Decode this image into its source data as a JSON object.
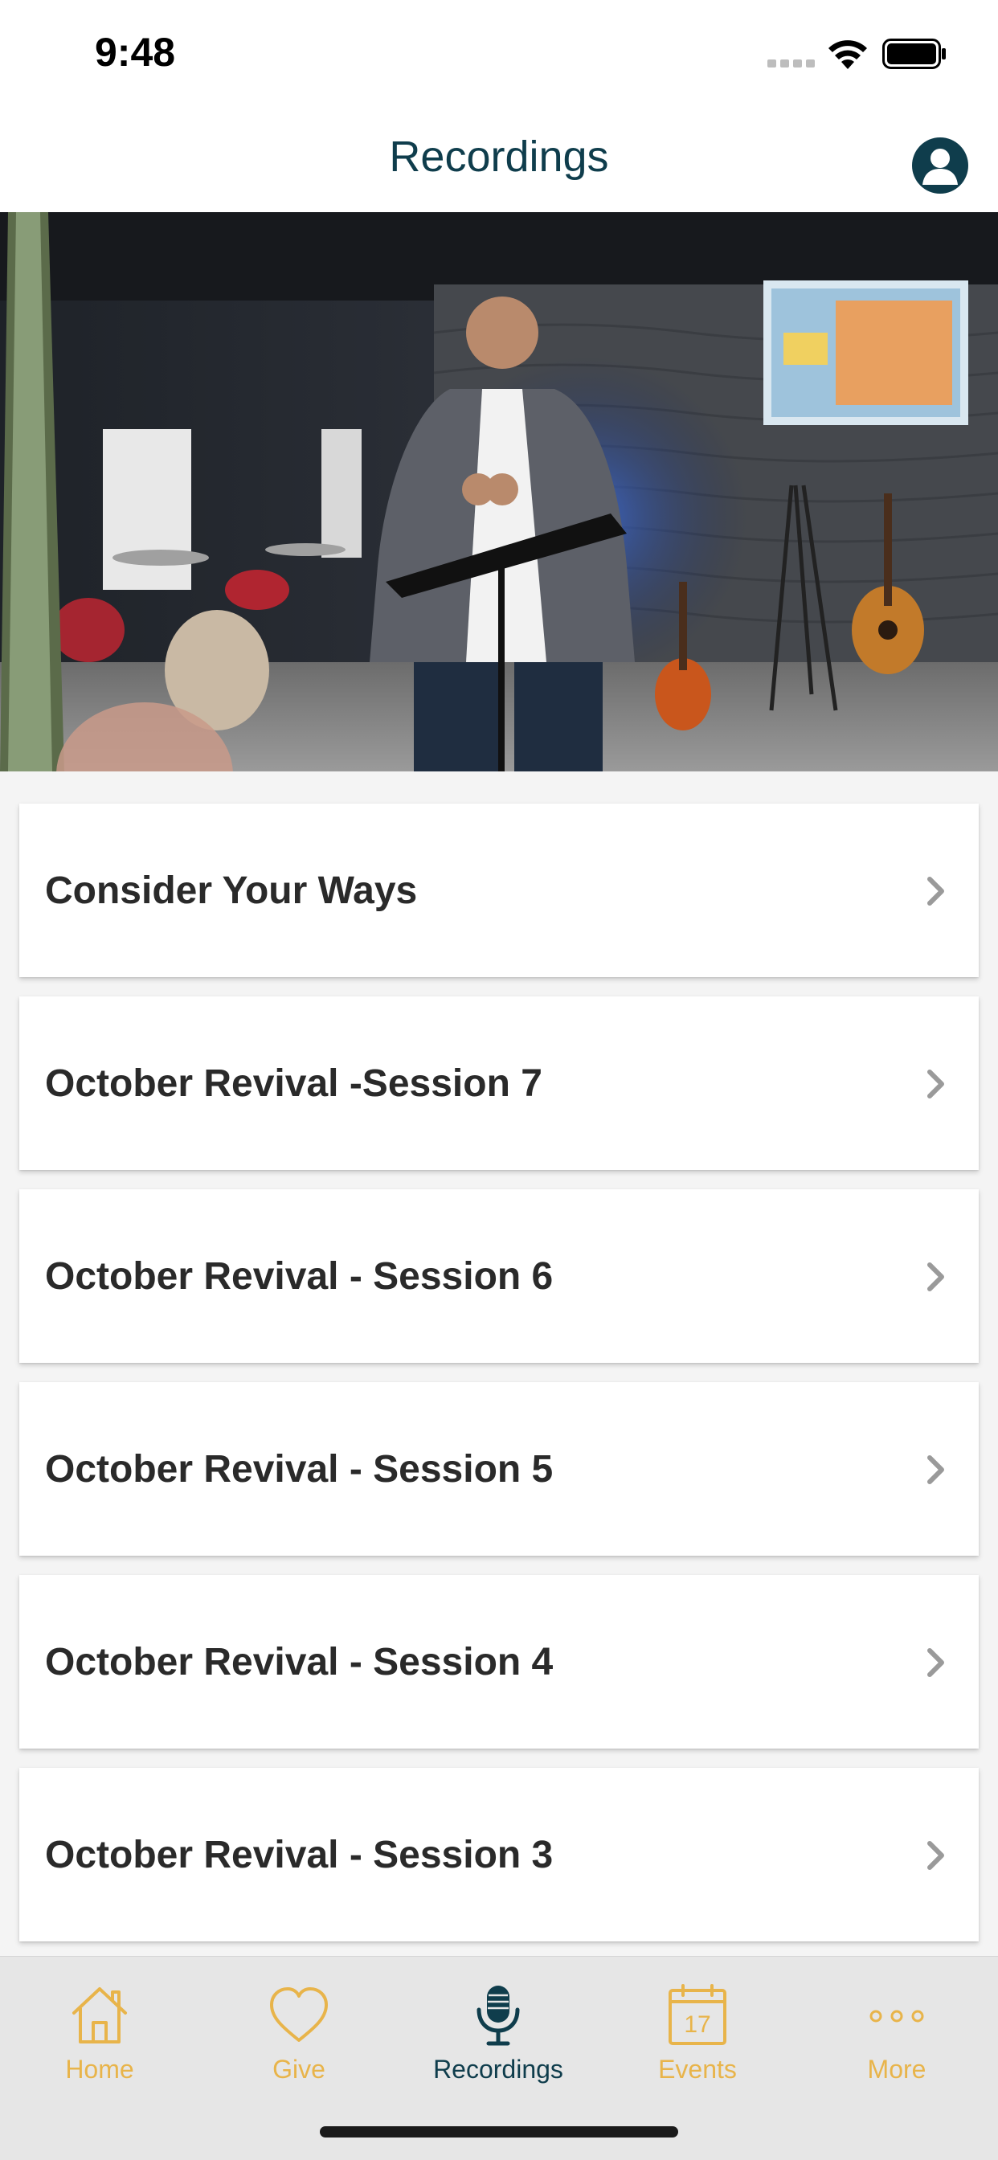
{
  "status_bar": {
    "time": "9:48"
  },
  "nav": {
    "title": "Recordings",
    "profile_icon": "person-circle-icon"
  },
  "hero": {
    "description_icon": "sermon-photo"
  },
  "recordings": [
    {
      "title": "Consider Your Ways"
    },
    {
      "title": "October Revival -Session 7"
    },
    {
      "title": "October Revival - Session 6"
    },
    {
      "title": "October Revival - Session 5"
    },
    {
      "title": "October Revival - Session 4"
    },
    {
      "title": "October Revival - Session 3"
    }
  ],
  "tabs": [
    {
      "label": "Home",
      "icon": "house-icon",
      "active": false
    },
    {
      "label": "Give",
      "icon": "heart-icon",
      "active": false
    },
    {
      "label": "Recordings",
      "icon": "microphone-icon",
      "active": true
    },
    {
      "label": "Events",
      "icon": "calendar-icon",
      "active": false,
      "calendar_day": "17"
    },
    {
      "label": "More",
      "icon": "ellipsis-icon",
      "active": false
    }
  ],
  "colors": {
    "accent": "#e8b44a",
    "primary": "#0f3d4c",
    "tab_bar_bg": "#e6e6e6"
  }
}
